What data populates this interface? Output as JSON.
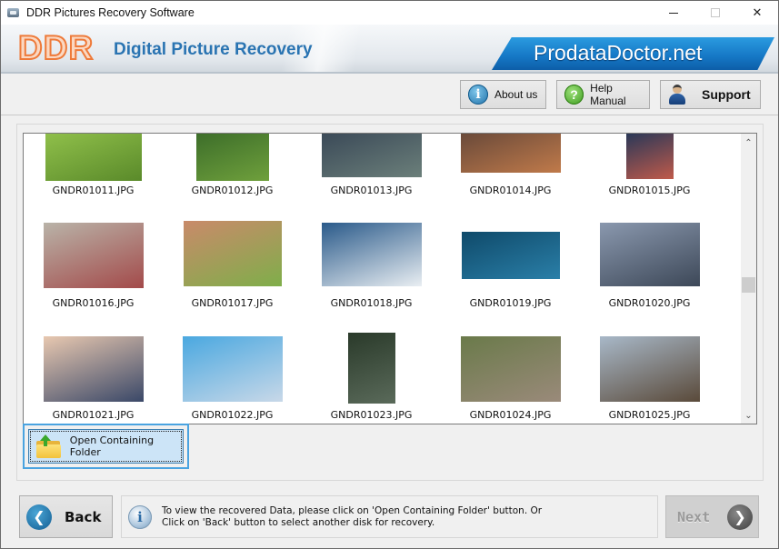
{
  "window": {
    "title": "DDR Pictures Recovery Software",
    "controls": {
      "minimize": "—",
      "maximize": "",
      "close": "✕"
    }
  },
  "banner": {
    "logo": "DDR",
    "title": "Digital Picture Recovery",
    "brand": "ProdataDoctor.net"
  },
  "toolbar": {
    "about_label": "About us",
    "about_icon": "i",
    "help_label": "Help Manual",
    "help_icon": "?",
    "support_label": "Support"
  },
  "gallery": {
    "items": [
      {
        "name": "GNDR01011.JPG",
        "colors": [
          "#8fbf4a",
          "#5a8a2a"
        ],
        "partial": true
      },
      {
        "name": "GNDR01012.JPG",
        "colors": [
          "#3d6e2a",
          "#6fa03c"
        ],
        "partial": true
      },
      {
        "name": "GNDR01013.JPG",
        "colors": [
          "#3b4a58",
          "#6b7f7a"
        ],
        "partial": true
      },
      {
        "name": "GNDR01014.JPG",
        "colors": [
          "#6a4a3a",
          "#c07a4a"
        ],
        "partial": true
      },
      {
        "name": "GNDR01015.JPG",
        "colors": [
          "#2a3858",
          "#c05a4a"
        ],
        "partial": true
      },
      {
        "name": "GNDR01016.JPG",
        "colors": [
          "#b9b3a8",
          "#a34a4a"
        ]
      },
      {
        "name": "GNDR01017.JPG",
        "colors": [
          "#c98a6a",
          "#7fae4a"
        ]
      },
      {
        "name": "GNDR01018.JPG",
        "colors": [
          "#2a5a8a",
          "#e9eef2"
        ]
      },
      {
        "name": "GNDR01019.JPG",
        "colors": [
          "#0f4a6a",
          "#2a7fa8"
        ]
      },
      {
        "name": "GNDR01020.JPG",
        "colors": [
          "#8a98ae",
          "#3d4858"
        ]
      },
      {
        "name": "GNDR01021.JPG",
        "colors": [
          "#e8c8b0",
          "#3a4868"
        ]
      },
      {
        "name": "GNDR01022.JPG",
        "colors": [
          "#4aa8e0",
          "#c8d8e8"
        ]
      },
      {
        "name": "GNDR01023.JPG",
        "colors": [
          "#2a3a2a",
          "#5a6a5a"
        ]
      },
      {
        "name": "GNDR01024.JPG",
        "colors": [
          "#6a7a4a",
          "#9a8a7a"
        ]
      },
      {
        "name": "GNDR01025.JPG",
        "colors": [
          "#a8b8c8",
          "#5a4a3a"
        ]
      }
    ]
  },
  "open_folder": {
    "label": "Open Containing Folder"
  },
  "footer": {
    "back_label": "Back",
    "info_icon": "i",
    "info_line1": "To view the recovered Data, please click on 'Open Containing Folder' button. Or",
    "info_line2": "Click on 'Back' button to select another disk for recovery.",
    "next_label": "Next",
    "next_enabled": false
  },
  "scrollbar": {
    "position_fraction": 0.55
  }
}
